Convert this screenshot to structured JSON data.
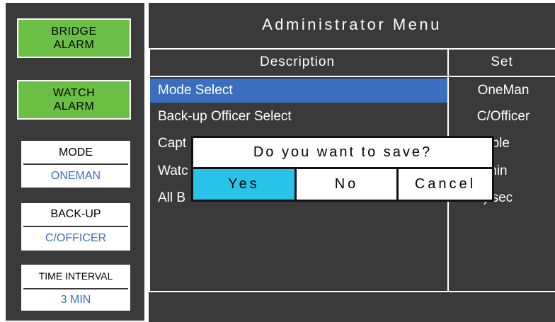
{
  "sidebar": {
    "bridge_alarm": [
      "BRIDGE",
      "ALARM"
    ],
    "watch_alarm": [
      "WATCH",
      "ALARM"
    ],
    "mode": {
      "title": "MODE",
      "value": "ONEMAN"
    },
    "backup": {
      "title": "BACK-UP",
      "value": "C/OFFICER"
    },
    "time_interval": {
      "title": "TIME INTERVAL",
      "value": "3 MIN"
    }
  },
  "main": {
    "title": "Administrator Menu",
    "columns": {
      "description": "Description",
      "set": "Set"
    },
    "rows": [
      {
        "description": "Mode Select",
        "set": "OneMan",
        "selected": true
      },
      {
        "description": "Back-up Officer Select",
        "set": "C/Officer"
      },
      {
        "description": "Capt",
        "set": "able"
      },
      {
        "description": "Watc",
        "set": "min"
      },
      {
        "description": "All B",
        "set": ") sec"
      }
    ]
  },
  "dialog": {
    "message": "Do you want to save?",
    "buttons": [
      "Yes",
      "No",
      "Cancel"
    ]
  },
  "colors": {
    "panel": "#3a3a3a",
    "alarm_green": "#6cbf45",
    "selection_blue": "#3a6fc0",
    "yes_cyan": "#29c3ea"
  }
}
